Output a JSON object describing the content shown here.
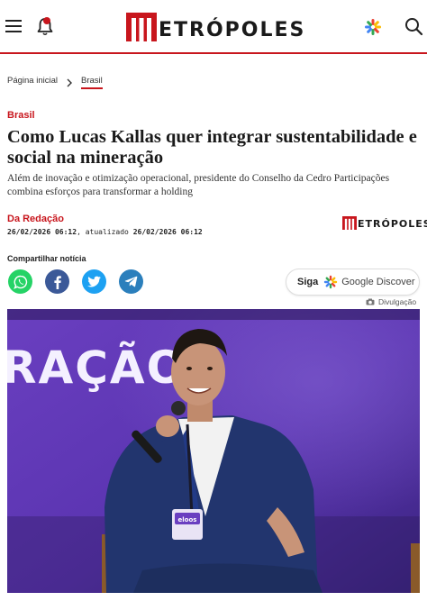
{
  "header": {
    "logo_text": "ETRÓPOLES",
    "logo_letter": "M",
    "brand_color": "#c8161d",
    "icons": [
      "menu-icon",
      "bell-icon",
      "google-discover-icon",
      "search-icon"
    ]
  },
  "breadcrumb": {
    "home": "Página inicial",
    "current": "Brasil"
  },
  "article": {
    "category": "Brasil",
    "title": "Como Lucas Kallas quer integrar sustentabilidade e social na mineração",
    "subtitle": "Além de inovação e otimização operacional, presidente do Conselho da Cedro Participações combina esforços para transformar a holding",
    "author": "Da Redação",
    "published": "26/02/2026 06:12",
    "updated_label": ", atualizado",
    "updated": "26/02/2026 06:12",
    "source_logo": "ETRÓPOLES"
  },
  "share": {
    "label": "Compartilhar notícia",
    "networks": [
      "whatsapp-icon",
      "facebook-icon",
      "twitter-icon",
      "telegram-icon"
    ]
  },
  "follow": {
    "prefix": "Siga",
    "label": "Google Discover"
  },
  "photo": {
    "credit": "Divulgação",
    "backdrop_text": "RAÇÃO",
    "badge_text": "eloos"
  }
}
